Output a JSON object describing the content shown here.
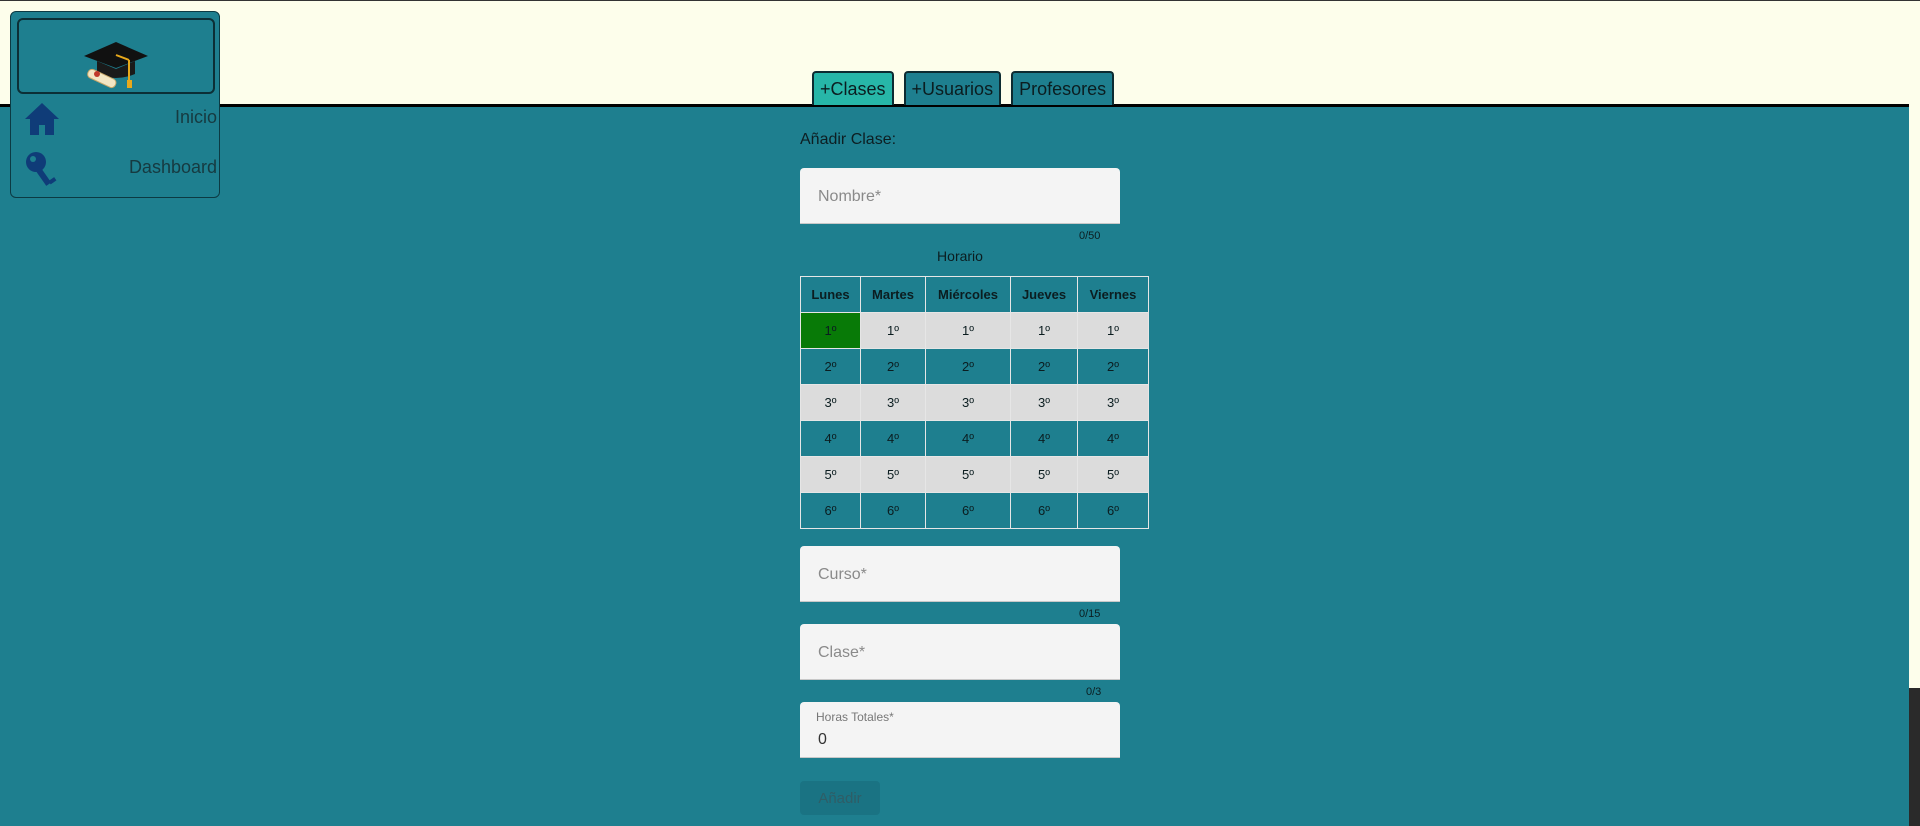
{
  "sidebar": {
    "logo_icon": "graduation-cap-icon",
    "items": [
      {
        "label": "Inicio",
        "icon": "home-icon"
      },
      {
        "label": "Dashboard",
        "icon": "key-icon"
      }
    ]
  },
  "tabs": [
    {
      "label": "+Clases",
      "active": true
    },
    {
      "label": "+Usuarios",
      "active": false
    },
    {
      "label": "Profesores",
      "active": false
    }
  ],
  "form": {
    "title": "Añadir Clase:",
    "nombre": {
      "placeholder": "Nombre*",
      "value": "",
      "counter": "0/50"
    },
    "horario": {
      "title": "Horario",
      "days": [
        "Lunes",
        "Martes",
        "Miércoles",
        "Jueves",
        "Viernes"
      ],
      "periods": [
        "1º",
        "2º",
        "3º",
        "4º",
        "5º",
        "6º"
      ],
      "selected": [
        {
          "day": "Lunes",
          "period": "1º"
        }
      ]
    },
    "curso": {
      "placeholder": "Curso*",
      "value": "",
      "counter": "0/15"
    },
    "clase": {
      "placeholder": "Clase*",
      "value": "",
      "counter": "0/3"
    },
    "horas": {
      "label": "Horas Totales*",
      "value": "0"
    },
    "submit_label": "Añadir"
  },
  "colors": {
    "header_bg": "#fdfeeb",
    "main_bg": "#1e7f8f",
    "active_tab": "#27b6a8",
    "selected_cell": "#087a07"
  }
}
